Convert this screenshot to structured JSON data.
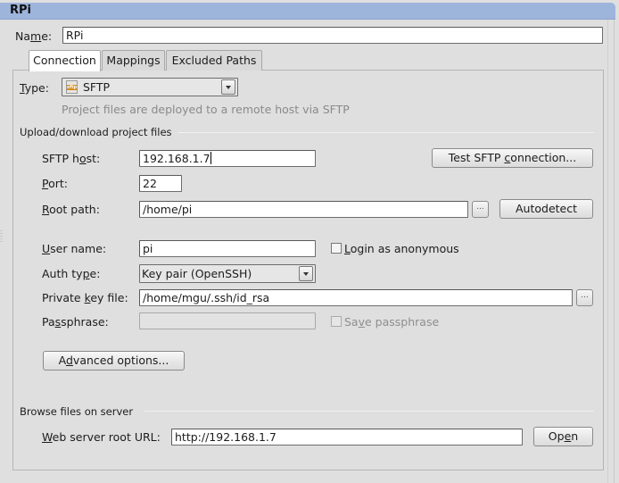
{
  "window": {
    "title": "RPi"
  },
  "name_field": {
    "label": "Name:",
    "label_underline_index": 2,
    "value": "RPi"
  },
  "tabs": [
    {
      "label": "Connection",
      "active": true
    },
    {
      "label": "Mappings",
      "active": false
    },
    {
      "label": "Excluded Paths",
      "active": false
    }
  ],
  "type_field": {
    "label": "Type:",
    "selected": "SFTP",
    "icon": "sftp-icon",
    "icon_text": "sftp",
    "hint": "Project files are deployed to a remote host via SFTP"
  },
  "upload_section": {
    "title": "Upload/download project files",
    "sftp_host": {
      "label": "SFTP host:",
      "value": "192.168.1.7"
    },
    "test_button": "Test SFTP connection...",
    "port": {
      "label": "Port:",
      "value": "22"
    },
    "root_path": {
      "label": "Root path:",
      "value": "/home/pi"
    },
    "browse_button": "...",
    "autodetect_button": "Autodetect",
    "user_name": {
      "label": "User name:",
      "value": "pi"
    },
    "login_anonymous": {
      "label": "Login as anonymous",
      "checked": false
    },
    "auth_type": {
      "label": "Auth type:",
      "selected": "Key pair (OpenSSH)"
    },
    "private_key": {
      "label": "Private key file:",
      "value": "/home/mgu/.ssh/id_rsa"
    },
    "private_key_browse": "...",
    "passphrase": {
      "label": "Passphrase:",
      "value": ""
    },
    "save_passphrase": {
      "label": "Save passphrase",
      "checked": false,
      "enabled": false
    },
    "advanced_button": "Advanced options..."
  },
  "browse_section": {
    "title": "Browse files on server",
    "web_root": {
      "label": "Web server root URL:",
      "value": "http://192.168.1.7"
    },
    "open_button": "Open"
  }
}
